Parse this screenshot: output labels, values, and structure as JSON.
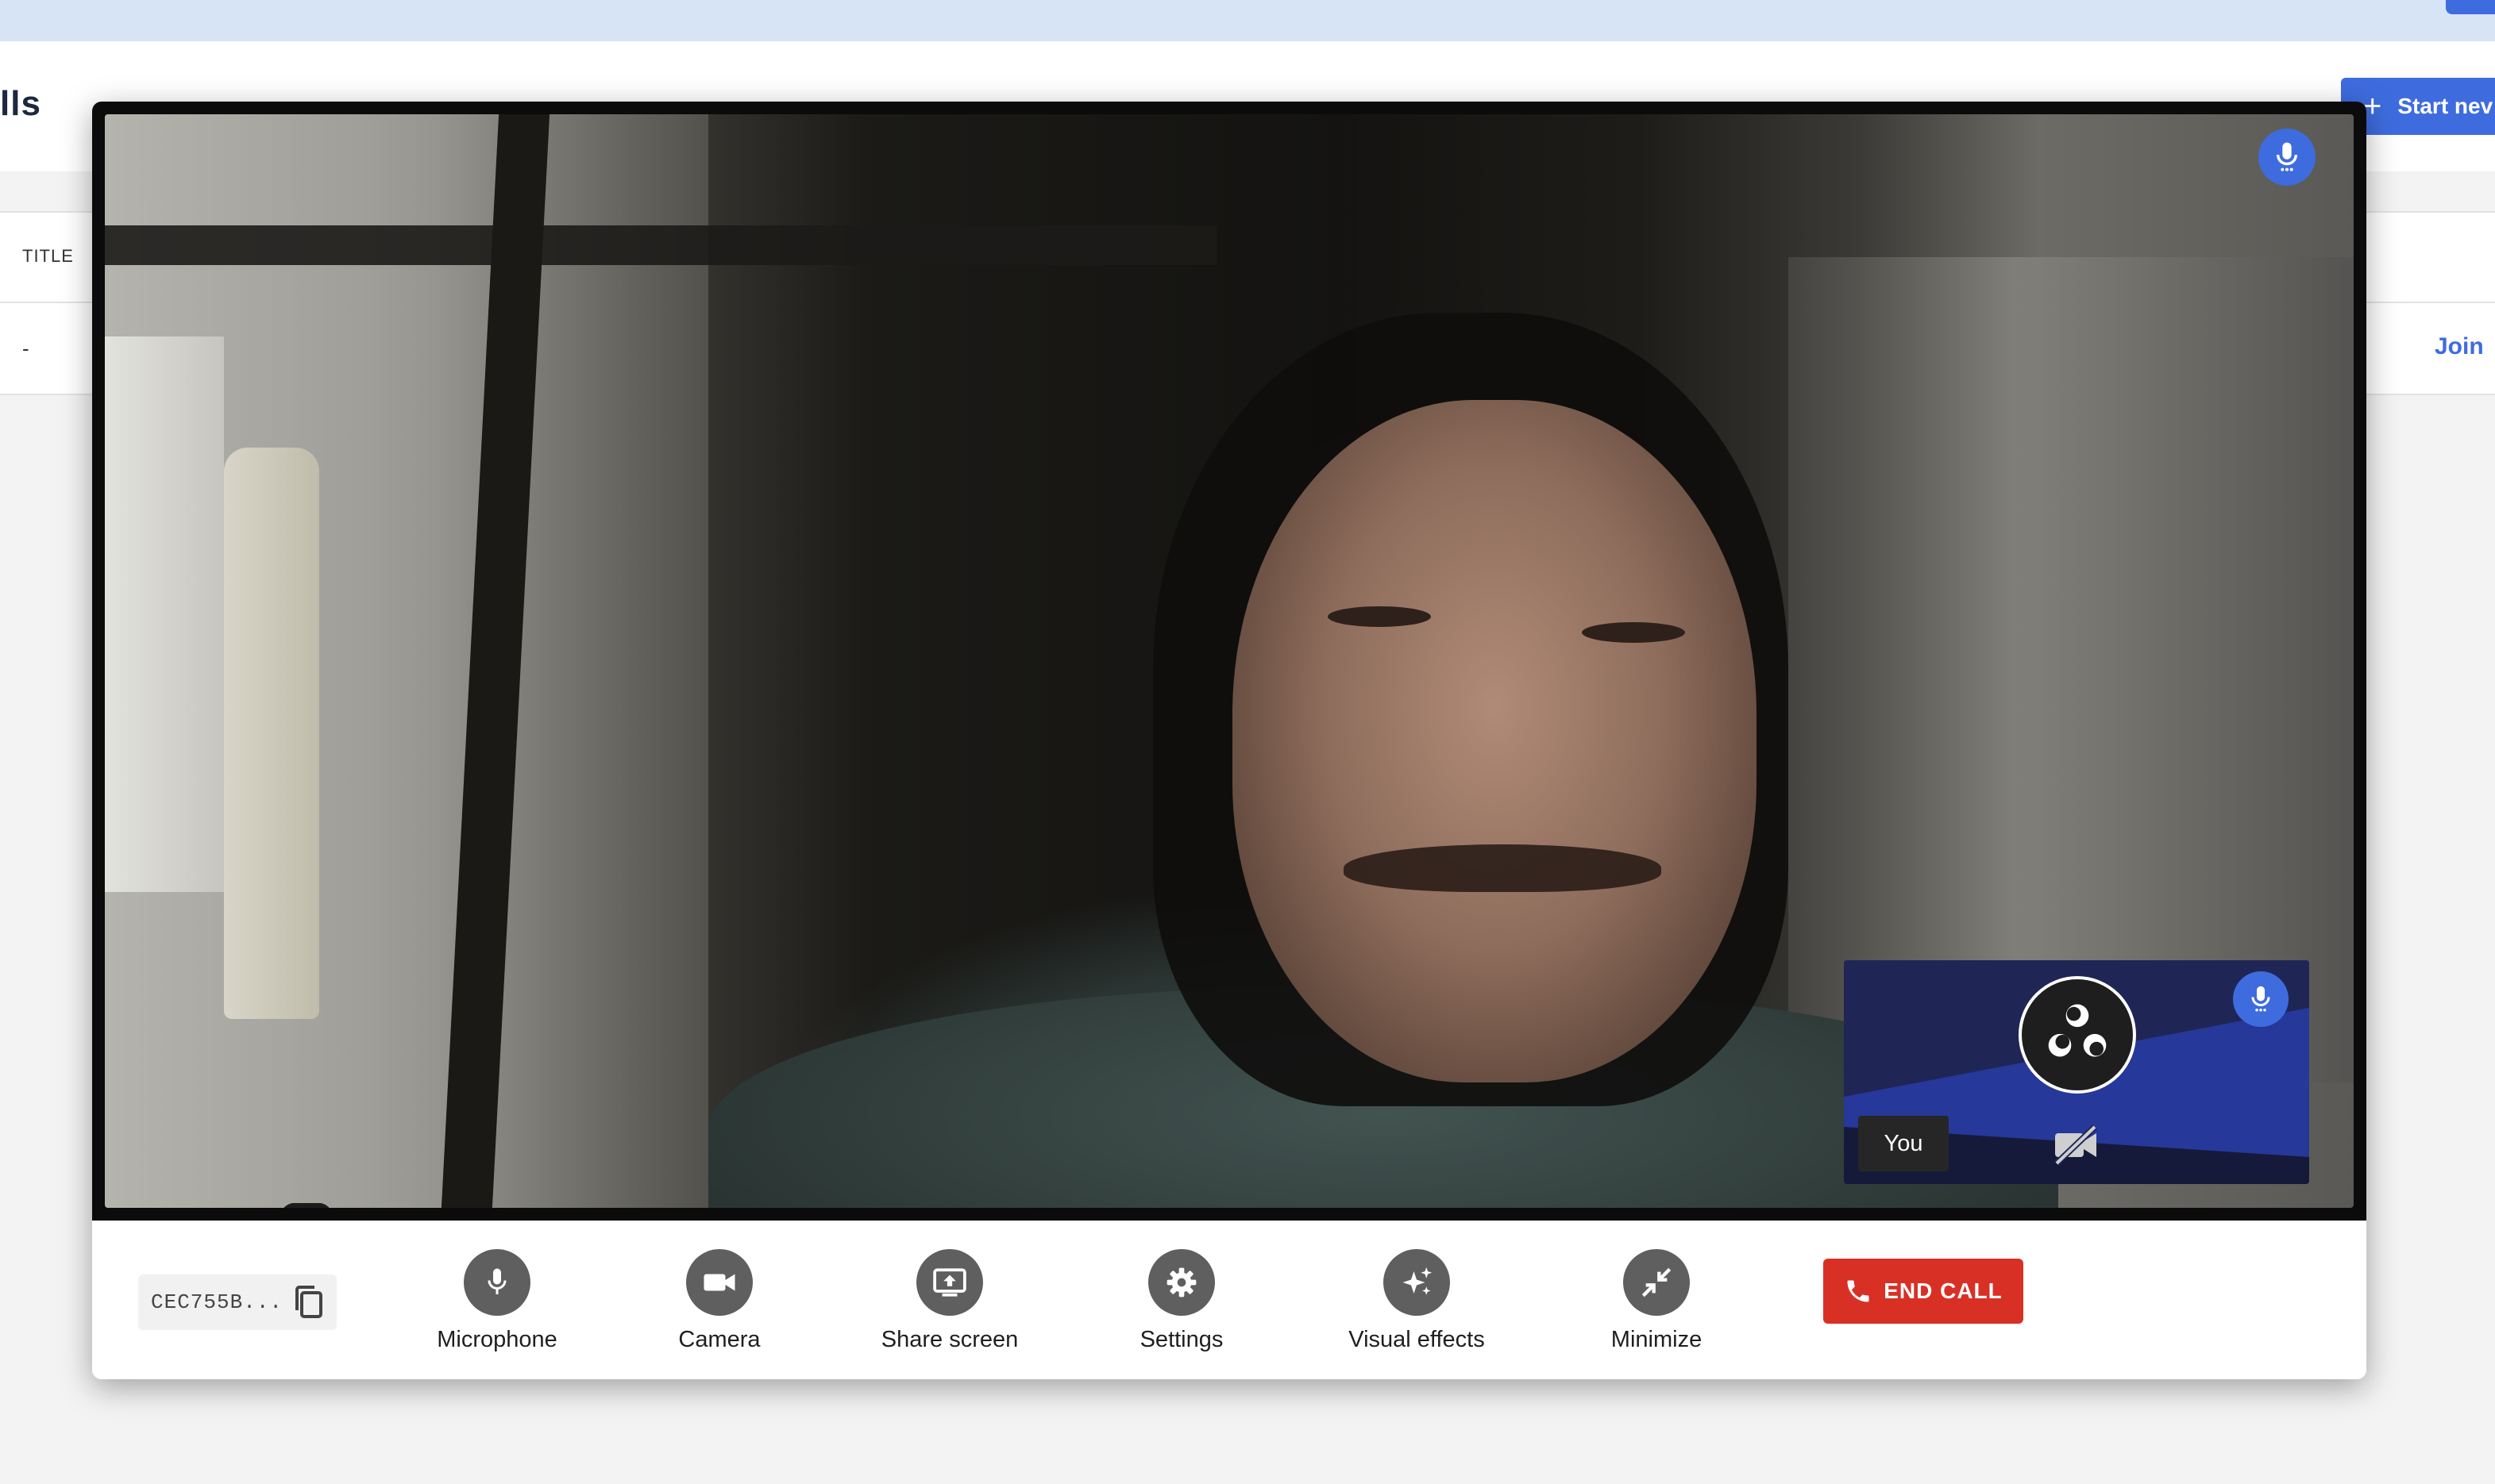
{
  "background_app": {
    "page_title": "lls",
    "start_button_label": "Start nev",
    "table": {
      "columns": [
        "TITLE"
      ],
      "rows": [
        {
          "title": "-",
          "action": "Join"
        }
      ]
    }
  },
  "call": {
    "main_video": {
      "mic_icon": "microphone-icon",
      "speaking": true
    },
    "self_view": {
      "label": "You",
      "avatar_icon": "obs-logo-icon",
      "camera_icon": "camera-off-icon",
      "mic_icon": "microphone-icon"
    },
    "call_id": "CEC755B...",
    "copy_icon": "copy-icon",
    "controls": [
      {
        "label": "Microphone",
        "icon": "microphone-icon"
      },
      {
        "label": "Camera",
        "icon": "videocam-icon"
      },
      {
        "label": "Share screen",
        "icon": "screen-share-icon"
      },
      {
        "label": "Settings",
        "icon": "gear-icon"
      },
      {
        "label": "Visual effects",
        "icon": "sparkle-icon"
      },
      {
        "label": "Minimize",
        "icon": "minimize-icon"
      }
    ],
    "end_call_label": "END CALL"
  },
  "colors": {
    "accent": "#3e6cdf",
    "end_call": "#d93025",
    "control_circle": "#5f5f5f",
    "self_view_bg": "#1f2656"
  }
}
